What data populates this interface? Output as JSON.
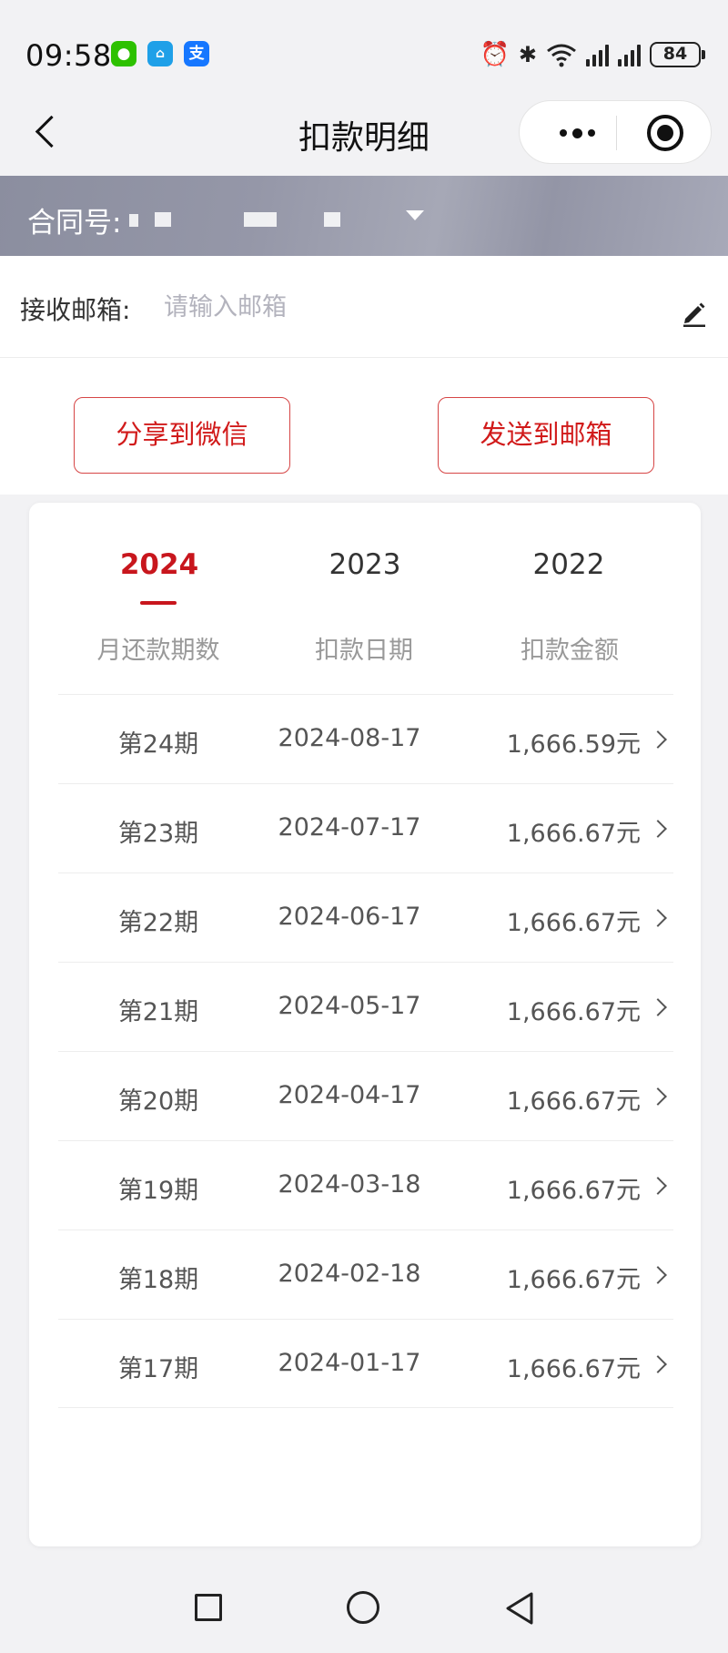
{
  "status_bar": {
    "time": "09:58",
    "app_icons": [
      "wechat-icon",
      "home-icon",
      "alipay-icon"
    ],
    "battery": "84"
  },
  "header": {
    "title": "扣款明细"
  },
  "contract": {
    "label": "合同号:"
  },
  "email": {
    "label": "接收邮箱:",
    "placeholder": "请输入邮箱",
    "value": ""
  },
  "actions": {
    "share_wechat": "分享到微信",
    "send_email": "发送到邮箱"
  },
  "year_tabs": [
    {
      "label": "2024",
      "active": true
    },
    {
      "label": "2023",
      "active": false
    },
    {
      "label": "2022",
      "active": false
    }
  ],
  "columns": [
    "月还款期数",
    "扣款日期",
    "扣款金额"
  ],
  "rows": [
    {
      "period": "第24期",
      "date": "2024-08-17",
      "amount": "1,666.59元"
    },
    {
      "period": "第23期",
      "date": "2024-07-17",
      "amount": "1,666.67元"
    },
    {
      "period": "第22期",
      "date": "2024-06-17",
      "amount": "1,666.67元"
    },
    {
      "period": "第21期",
      "date": "2024-05-17",
      "amount": "1,666.67元"
    },
    {
      "period": "第20期",
      "date": "2024-04-17",
      "amount": "1,666.67元"
    },
    {
      "period": "第19期",
      "date": "2024-03-18",
      "amount": "1,666.67元"
    },
    {
      "period": "第18期",
      "date": "2024-02-18",
      "amount": "1,666.67元"
    },
    {
      "period": "第17期",
      "date": "2024-01-17",
      "amount": "1,666.67元"
    }
  ],
  "colors": {
    "accent": "#c8161d",
    "button_border": "#d64545",
    "header_bar": "#9597a8"
  }
}
